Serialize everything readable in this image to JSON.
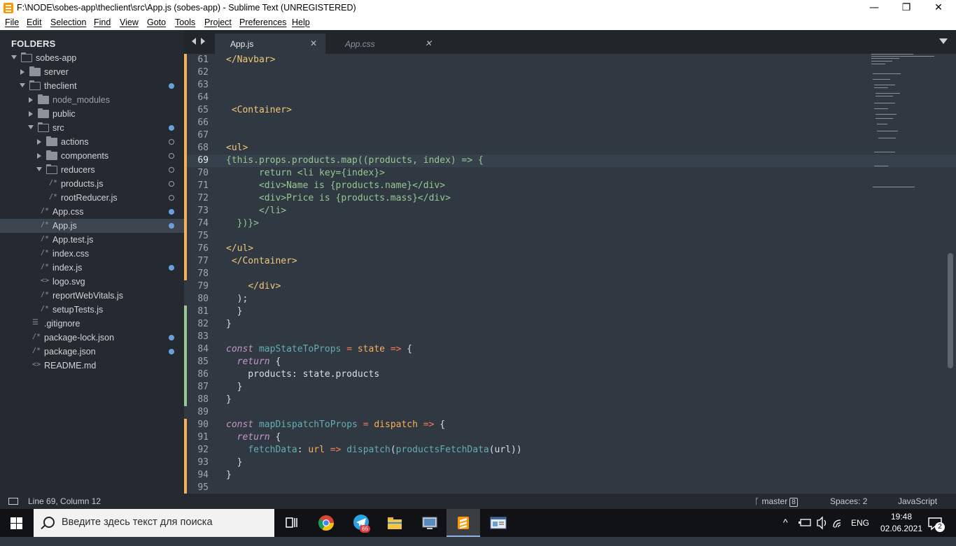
{
  "window": {
    "title": "F:\\NODE\\sobes-app\\theclient\\src\\App.js (sobes-app) - Sublime Text (UNREGISTERED)",
    "minimize": "—",
    "maximize": "❐",
    "close": "✕"
  },
  "menu": [
    "File",
    "Edit",
    "Selection",
    "Find",
    "View",
    "Goto",
    "Tools",
    "Project",
    "Preferences",
    "Help"
  ],
  "sidebar": {
    "header": "FOLDERS",
    "items": [
      {
        "label": "sobes-app",
        "type": "folder",
        "open": true,
        "depth": 0,
        "dot": "none"
      },
      {
        "label": "server",
        "type": "folder",
        "open": false,
        "depth": 1,
        "dot": "none"
      },
      {
        "label": "theclient",
        "type": "folder",
        "open": true,
        "depth": 1,
        "dot": "filled"
      },
      {
        "label": "node_modules",
        "type": "folder",
        "open": false,
        "depth": 2,
        "dot": "none",
        "dim": true
      },
      {
        "label": "public",
        "type": "folder",
        "open": false,
        "depth": 2,
        "dot": "none"
      },
      {
        "label": "src",
        "type": "folder",
        "open": true,
        "depth": 2,
        "dot": "filled"
      },
      {
        "label": "actions",
        "type": "folder",
        "open": false,
        "depth": 3,
        "dot": "hollow"
      },
      {
        "label": "components",
        "type": "folder",
        "open": false,
        "depth": 3,
        "dot": "hollow"
      },
      {
        "label": "reducers",
        "type": "folder",
        "open": true,
        "depth": 3,
        "dot": "hollow"
      },
      {
        "label": "products.js",
        "type": "file",
        "icon": "/*",
        "depth": 4,
        "dot": "hollow"
      },
      {
        "label": "rootReducer.js",
        "type": "file",
        "icon": "/*",
        "depth": 4,
        "dot": "hollow"
      },
      {
        "label": "App.css",
        "type": "file",
        "icon": "/*",
        "depth": 3,
        "dot": "filled"
      },
      {
        "label": "App.js",
        "type": "file",
        "icon": "/*",
        "depth": 3,
        "dot": "filled",
        "selected": true
      },
      {
        "label": "App.test.js",
        "type": "file",
        "icon": "/*",
        "depth": 3,
        "dot": "none"
      },
      {
        "label": "index.css",
        "type": "file",
        "icon": "/*",
        "depth": 3,
        "dot": "none"
      },
      {
        "label": "index.js",
        "type": "file",
        "icon": "/*",
        "depth": 3,
        "dot": "filled"
      },
      {
        "label": "logo.svg",
        "type": "file",
        "icon": "<>",
        "depth": 3,
        "dot": "none"
      },
      {
        "label": "reportWebVitals.js",
        "type": "file",
        "icon": "/*",
        "depth": 3,
        "dot": "none"
      },
      {
        "label": "setupTests.js",
        "type": "file",
        "icon": "/*",
        "depth": 3,
        "dot": "none"
      },
      {
        "label": ".gitignore",
        "type": "file",
        "icon": "☰",
        "depth": 2,
        "dot": "none"
      },
      {
        "label": "package-lock.json",
        "type": "file",
        "icon": "/*",
        "depth": 2,
        "dot": "filled"
      },
      {
        "label": "package.json",
        "type": "file",
        "icon": "/*",
        "depth": 2,
        "dot": "filled"
      },
      {
        "label": "README.md",
        "type": "file",
        "icon": "<>",
        "depth": 2,
        "dot": "none"
      }
    ]
  },
  "tabs": [
    {
      "label": "App.js",
      "active": true,
      "close": "✕"
    },
    {
      "label": "App.css",
      "active": false,
      "close": "✕"
    }
  ],
  "editor": {
    "current_line": 69,
    "lines": [
      {
        "n": "61",
        "tokens": [
          [
            "c-tag",
            "</Navbar>"
          ]
        ]
      },
      {
        "n": "62",
        "tokens": []
      },
      {
        "n": "63",
        "tokens": []
      },
      {
        "n": "64",
        "tokens": []
      },
      {
        "n": "65",
        "tokens": [
          [
            "c-plain",
            " "
          ],
          [
            "c-tag",
            "<Container>"
          ]
        ]
      },
      {
        "n": "66",
        "tokens": []
      },
      {
        "n": "67",
        "tokens": []
      },
      {
        "n": "68",
        "tokens": [
          [
            "c-tag",
            "<ul>"
          ]
        ]
      },
      {
        "n": "69",
        "tokens": [
          [
            "c-green",
            "{this.props.products.map((products, index) => {"
          ]
        ]
      },
      {
        "n": "70",
        "tokens": [
          [
            "c-green",
            "      return <li key={index}>"
          ]
        ]
      },
      {
        "n": "71",
        "tokens": [
          [
            "c-green",
            "      <div>Name is {products.name}</div>"
          ]
        ]
      },
      {
        "n": "72",
        "tokens": [
          [
            "c-green",
            "      <div>Price is {products.mass}</div>"
          ]
        ]
      },
      {
        "n": "73",
        "tokens": [
          [
            "c-green",
            "      </li>"
          ]
        ]
      },
      {
        "n": "74",
        "tokens": [
          [
            "c-green",
            "  })}>"
          ]
        ]
      },
      {
        "n": "75",
        "tokens": []
      },
      {
        "n": "76",
        "tokens": [
          [
            "c-tag",
            "</ul>"
          ]
        ]
      },
      {
        "n": "77",
        "tokens": [
          [
            "c-plain",
            " "
          ],
          [
            "c-tag",
            "</Container>"
          ]
        ]
      },
      {
        "n": "78",
        "tokens": []
      },
      {
        "n": "79",
        "tokens": [
          [
            "c-plain",
            "    "
          ],
          [
            "c-tag",
            "</div>"
          ]
        ]
      },
      {
        "n": "80",
        "tokens": [
          [
            "c-plain",
            "  );"
          ]
        ]
      },
      {
        "n": "81",
        "tokens": [
          [
            "c-plain",
            "  }"
          ]
        ]
      },
      {
        "n": "82",
        "tokens": [
          [
            "c-plain",
            "}"
          ]
        ]
      },
      {
        "n": "83",
        "tokens": []
      },
      {
        "n": "84",
        "tokens": [
          [
            "c-kw",
            "const"
          ],
          [
            "c-plain",
            " "
          ],
          [
            "c-fn",
            "mapStateToProps"
          ],
          [
            "c-plain",
            " "
          ],
          [
            "c-op",
            "="
          ],
          [
            "c-plain",
            " "
          ],
          [
            "c-var",
            "state"
          ],
          [
            "c-plain",
            " "
          ],
          [
            "c-op",
            "=>"
          ],
          [
            "c-plain",
            " {"
          ]
        ]
      },
      {
        "n": "85",
        "tokens": [
          [
            "c-plain",
            "  "
          ],
          [
            "c-kw",
            "return"
          ],
          [
            "c-plain",
            " {"
          ]
        ]
      },
      {
        "n": "86",
        "tokens": [
          [
            "c-plain",
            "    products: state.products"
          ]
        ]
      },
      {
        "n": "87",
        "tokens": [
          [
            "c-plain",
            "  }"
          ]
        ]
      },
      {
        "n": "88",
        "tokens": [
          [
            "c-plain",
            "}"
          ]
        ]
      },
      {
        "n": "89",
        "tokens": []
      },
      {
        "n": "90",
        "tokens": [
          [
            "c-kw",
            "const"
          ],
          [
            "c-plain",
            " "
          ],
          [
            "c-fn",
            "mapDispatchToProps"
          ],
          [
            "c-plain",
            " "
          ],
          [
            "c-op",
            "="
          ],
          [
            "c-plain",
            " "
          ],
          [
            "c-var",
            "dispatch"
          ],
          [
            "c-plain",
            " "
          ],
          [
            "c-op",
            "=>"
          ],
          [
            "c-plain",
            " {"
          ]
        ]
      },
      {
        "n": "91",
        "tokens": [
          [
            "c-plain",
            "  "
          ],
          [
            "c-kw",
            "return"
          ],
          [
            "c-plain",
            " {"
          ]
        ]
      },
      {
        "n": "92",
        "tokens": [
          [
            "c-plain",
            "    "
          ],
          [
            "c-fn",
            "fetchData"
          ],
          [
            "c-plain",
            ": "
          ],
          [
            "c-var",
            "url"
          ],
          [
            "c-plain",
            " "
          ],
          [
            "c-op",
            "=>"
          ],
          [
            "c-plain",
            " "
          ],
          [
            "c-fn",
            "dispatch"
          ],
          [
            "c-plain",
            "("
          ],
          [
            "c-fn",
            "productsFetchData"
          ],
          [
            "c-plain",
            "(url))"
          ]
        ]
      },
      {
        "n": "93",
        "tokens": [
          [
            "c-plain",
            "  }"
          ]
        ]
      },
      {
        "n": "94",
        "tokens": [
          [
            "c-plain",
            "}"
          ]
        ]
      },
      {
        "n": "95",
        "tokens": []
      }
    ]
  },
  "statusbar": {
    "position": "Line 69, Column 12",
    "branch": "master",
    "branch_count": "8",
    "spaces": "Spaces: 2",
    "syntax": "JavaScript"
  },
  "taskbar": {
    "search_placeholder": "Введите здесь текст для поиска",
    "telegram_badge": "66",
    "lang": "ENG",
    "time": "19:48",
    "date": "02.06.2021",
    "notifications": "2",
    "tray_chevron": "^"
  },
  "colors": {
    "editor_bg": "#303841",
    "sidebar_bg": "#252a30",
    "accent_modified": "#6a9fe0",
    "gutter_modified": "#f9ae58",
    "gutter_added": "#99c794"
  }
}
